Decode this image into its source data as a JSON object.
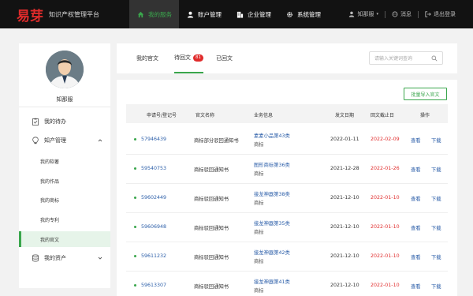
{
  "header": {
    "logo": "易芽",
    "platform": "知识产权管理平台",
    "nav": [
      {
        "label": "我的服务",
        "icon": "home-icon",
        "active": true
      },
      {
        "label": "账户管理",
        "icon": "user-icon",
        "active": false
      },
      {
        "label": "企业管理",
        "icon": "building-icon",
        "active": false
      },
      {
        "label": "系统管理",
        "icon": "gear-icon",
        "active": false
      }
    ],
    "user": "知那服",
    "messages": "消息",
    "logout": "退出登录"
  },
  "sidebar": {
    "username": "知那服",
    "items": {
      "todo": "我的待办",
      "ip": "知产管理",
      "assets": "我的资产"
    },
    "subitems": [
      "我的软著",
      "我的作品",
      "我的商标",
      "我的专利",
      "我的官文"
    ],
    "active_sub": "我的官文"
  },
  "tabs": {
    "my_docs": "我的官文",
    "pending": "待回文",
    "pending_count": "81",
    "done": "已回文"
  },
  "search": {
    "placeholder": "请输入关键词查询"
  },
  "import_button": "批量导入官文",
  "table": {
    "headers": [
      "申请号/登记号",
      "官文名称",
      "业务信息",
      "发文日期",
      "回文截止日",
      "操作"
    ],
    "rows": [
      {
        "reg": "57946439",
        "name": "商标部分驳回通知书",
        "biz": "素素小品第43类",
        "biz_sub": "商标",
        "issued": "2022-01-11",
        "deadline": "2022-02-09",
        "view": "查看",
        "download": "下载"
      },
      {
        "reg": "59540753",
        "name": "商标驳回通知书",
        "biz": "图形商标第36类",
        "biz_sub": "商标",
        "issued": "2021-12-28",
        "deadline": "2022-01-26",
        "view": "查看",
        "download": "下载"
      },
      {
        "reg": "59602449",
        "name": "商标驳回通知书",
        "biz": "接龙神器第38类",
        "biz_sub": "商标",
        "issued": "2021-12-10",
        "deadline": "2022-01-10",
        "view": "查看",
        "download": "下载"
      },
      {
        "reg": "59606948",
        "name": "商标驳回通知书",
        "biz": "接龙神器第35类",
        "biz_sub": "商标",
        "issued": "2021-12-10",
        "deadline": "2022-01-10",
        "view": "查看",
        "download": "下载"
      },
      {
        "reg": "59611232",
        "name": "商标驳回通知书",
        "biz": "接龙神器第42类",
        "biz_sub": "商标",
        "issued": "2021-12-10",
        "deadline": "2022-01-10",
        "view": "查看",
        "download": "下载"
      },
      {
        "reg": "59613307",
        "name": "商标驳回通知书",
        "biz": "接龙神器第41类",
        "biz_sub": "商标",
        "issued": "2021-12-10",
        "deadline": "2022-01-10",
        "view": "查看",
        "download": "下载"
      }
    ]
  },
  "colors": {
    "accent": "#3aa64c",
    "brand": "#e02b2b",
    "link": "#2a5da8",
    "topbar": "#121212"
  }
}
